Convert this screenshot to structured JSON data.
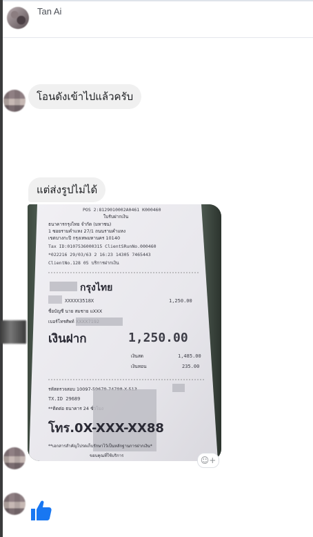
{
  "header": {
    "contact_name": "Tan Ai"
  },
  "messages": [
    {
      "text": "โอนดังเข้าไปแล้วครับ"
    },
    {
      "text": "แต่ส่งรูปไม่ได้"
    }
  ],
  "receipt": {
    "line1": "POS 2:8129010002A0461  K000460",
    "line2": "ใบรับฝากเงิน",
    "line3": "ธนาคารกรุงไทย จำกัด (มหาชน)",
    "line4": "1 ซอยรามคำแหง 27/1 ถนนรามคำแหง",
    "line5": "เขตบางกะปิ กรุงเทพมหานคร 10140",
    "line6": "Tax ID:0107536000315 ClientSRunNo.000460",
    "line7": "*022216 29/03/63 2 16:23 14305 7465443",
    "line8": "ClientNo.128 05 บริการฝากเงิน",
    "bank": "กรุงไทย",
    "account": "XXXXX3518X",
    "amount_small": "1,250.00",
    "name": "ชื่อบัญชี นาย สมชาย แXXX",
    "phone_masked": "เบอร์โทรศัพท์ XXXX7192",
    "deposit_label": "เงินฝาก",
    "deposit_amount": "1,250.00",
    "cash_label": "เงินสด",
    "cash_value": "1,485.00",
    "change_label": "เงินทอน",
    "change_value": "235.00",
    "verify": "รหัสตรวจสอบ 10097-59679-74798-X-513",
    "tx": "TX.ID 29689",
    "contact": "**ติดต่อ ธนาคาร 24 ชั่วโมง",
    "tel": "โทร.0X-XXX-XX88",
    "footer1": "**เอกสารสำคัญโปรดเก็บรักษาไว้เป็นหลักฐานการฝากเงิน*",
    "footer2": "ขอบคุณที่ใช้บริการ"
  },
  "reaction_button": {
    "icon": "smiley-plus-icon",
    "glyph": "☺+"
  },
  "like_button": {
    "icon": "thumbs-up-icon",
    "color": "#1877f2"
  }
}
